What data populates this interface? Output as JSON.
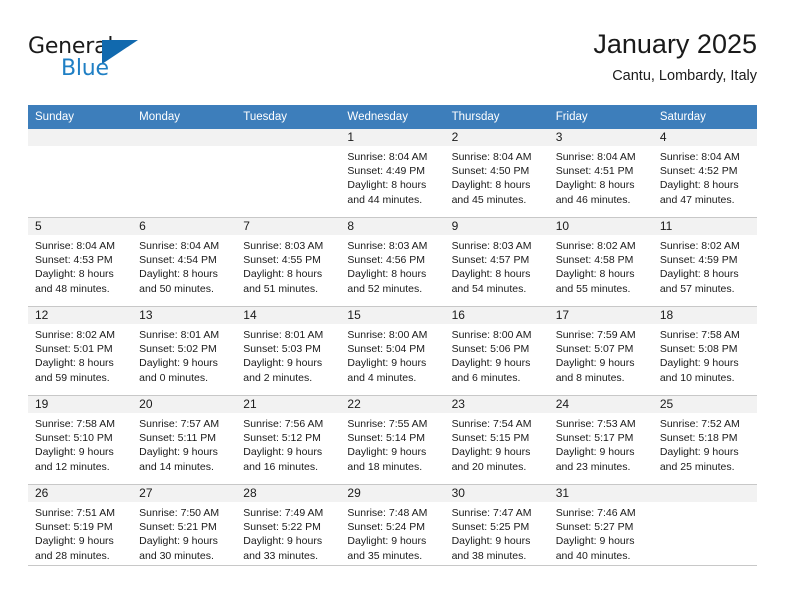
{
  "brand": {
    "name_top": "General",
    "name_bottom": "Blue",
    "accent_color": "#1169ae",
    "text_color": "#1a1a1a"
  },
  "header": {
    "title": "January 2025",
    "subtitle": "Cantu, Lombardy, Italy"
  },
  "theme": {
    "header_row_bg": "#3d7ebb",
    "header_row_text": "#ffffff",
    "daynum_band_bg": "#f2f2f2",
    "grid_line": "#c8c8c8"
  },
  "weekdays": [
    "Sunday",
    "Monday",
    "Tuesday",
    "Wednesday",
    "Thursday",
    "Friday",
    "Saturday"
  ],
  "weeks": [
    [
      {
        "day": "",
        "empty": true,
        "sunrise": "",
        "sunset": "",
        "daylight_line1": "",
        "daylight_line2": ""
      },
      {
        "day": "",
        "empty": true,
        "sunrise": "",
        "sunset": "",
        "daylight_line1": "",
        "daylight_line2": ""
      },
      {
        "day": "",
        "empty": true,
        "sunrise": "",
        "sunset": "",
        "daylight_line1": "",
        "daylight_line2": ""
      },
      {
        "day": "1",
        "empty": false,
        "sunrise": "Sunrise: 8:04 AM",
        "sunset": "Sunset: 4:49 PM",
        "daylight_line1": "Daylight: 8 hours",
        "daylight_line2": "and 44 minutes."
      },
      {
        "day": "2",
        "empty": false,
        "sunrise": "Sunrise: 8:04 AM",
        "sunset": "Sunset: 4:50 PM",
        "daylight_line1": "Daylight: 8 hours",
        "daylight_line2": "and 45 minutes."
      },
      {
        "day": "3",
        "empty": false,
        "sunrise": "Sunrise: 8:04 AM",
        "sunset": "Sunset: 4:51 PM",
        "daylight_line1": "Daylight: 8 hours",
        "daylight_line2": "and 46 minutes."
      },
      {
        "day": "4",
        "empty": false,
        "sunrise": "Sunrise: 8:04 AM",
        "sunset": "Sunset: 4:52 PM",
        "daylight_line1": "Daylight: 8 hours",
        "daylight_line2": "and 47 minutes."
      }
    ],
    [
      {
        "day": "5",
        "empty": false,
        "sunrise": "Sunrise: 8:04 AM",
        "sunset": "Sunset: 4:53 PM",
        "daylight_line1": "Daylight: 8 hours",
        "daylight_line2": "and 48 minutes."
      },
      {
        "day": "6",
        "empty": false,
        "sunrise": "Sunrise: 8:04 AM",
        "sunset": "Sunset: 4:54 PM",
        "daylight_line1": "Daylight: 8 hours",
        "daylight_line2": "and 50 minutes."
      },
      {
        "day": "7",
        "empty": false,
        "sunrise": "Sunrise: 8:03 AM",
        "sunset": "Sunset: 4:55 PM",
        "daylight_line1": "Daylight: 8 hours",
        "daylight_line2": "and 51 minutes."
      },
      {
        "day": "8",
        "empty": false,
        "sunrise": "Sunrise: 8:03 AM",
        "sunset": "Sunset: 4:56 PM",
        "daylight_line1": "Daylight: 8 hours",
        "daylight_line2": "and 52 minutes."
      },
      {
        "day": "9",
        "empty": false,
        "sunrise": "Sunrise: 8:03 AM",
        "sunset": "Sunset: 4:57 PM",
        "daylight_line1": "Daylight: 8 hours",
        "daylight_line2": "and 54 minutes."
      },
      {
        "day": "10",
        "empty": false,
        "sunrise": "Sunrise: 8:02 AM",
        "sunset": "Sunset: 4:58 PM",
        "daylight_line1": "Daylight: 8 hours",
        "daylight_line2": "and 55 minutes."
      },
      {
        "day": "11",
        "empty": false,
        "sunrise": "Sunrise: 8:02 AM",
        "sunset": "Sunset: 4:59 PM",
        "daylight_line1": "Daylight: 8 hours",
        "daylight_line2": "and 57 minutes."
      }
    ],
    [
      {
        "day": "12",
        "empty": false,
        "sunrise": "Sunrise: 8:02 AM",
        "sunset": "Sunset: 5:01 PM",
        "daylight_line1": "Daylight: 8 hours",
        "daylight_line2": "and 59 minutes."
      },
      {
        "day": "13",
        "empty": false,
        "sunrise": "Sunrise: 8:01 AM",
        "sunset": "Sunset: 5:02 PM",
        "daylight_line1": "Daylight: 9 hours",
        "daylight_line2": "and 0 minutes."
      },
      {
        "day": "14",
        "empty": false,
        "sunrise": "Sunrise: 8:01 AM",
        "sunset": "Sunset: 5:03 PM",
        "daylight_line1": "Daylight: 9 hours",
        "daylight_line2": "and 2 minutes."
      },
      {
        "day": "15",
        "empty": false,
        "sunrise": "Sunrise: 8:00 AM",
        "sunset": "Sunset: 5:04 PM",
        "daylight_line1": "Daylight: 9 hours",
        "daylight_line2": "and 4 minutes."
      },
      {
        "day": "16",
        "empty": false,
        "sunrise": "Sunrise: 8:00 AM",
        "sunset": "Sunset: 5:06 PM",
        "daylight_line1": "Daylight: 9 hours",
        "daylight_line2": "and 6 minutes."
      },
      {
        "day": "17",
        "empty": false,
        "sunrise": "Sunrise: 7:59 AM",
        "sunset": "Sunset: 5:07 PM",
        "daylight_line1": "Daylight: 9 hours",
        "daylight_line2": "and 8 minutes."
      },
      {
        "day": "18",
        "empty": false,
        "sunrise": "Sunrise: 7:58 AM",
        "sunset": "Sunset: 5:08 PM",
        "daylight_line1": "Daylight: 9 hours",
        "daylight_line2": "and 10 minutes."
      }
    ],
    [
      {
        "day": "19",
        "empty": false,
        "sunrise": "Sunrise: 7:58 AM",
        "sunset": "Sunset: 5:10 PM",
        "daylight_line1": "Daylight: 9 hours",
        "daylight_line2": "and 12 minutes."
      },
      {
        "day": "20",
        "empty": false,
        "sunrise": "Sunrise: 7:57 AM",
        "sunset": "Sunset: 5:11 PM",
        "daylight_line1": "Daylight: 9 hours",
        "daylight_line2": "and 14 minutes."
      },
      {
        "day": "21",
        "empty": false,
        "sunrise": "Sunrise: 7:56 AM",
        "sunset": "Sunset: 5:12 PM",
        "daylight_line1": "Daylight: 9 hours",
        "daylight_line2": "and 16 minutes."
      },
      {
        "day": "22",
        "empty": false,
        "sunrise": "Sunrise: 7:55 AM",
        "sunset": "Sunset: 5:14 PM",
        "daylight_line1": "Daylight: 9 hours",
        "daylight_line2": "and 18 minutes."
      },
      {
        "day": "23",
        "empty": false,
        "sunrise": "Sunrise: 7:54 AM",
        "sunset": "Sunset: 5:15 PM",
        "daylight_line1": "Daylight: 9 hours",
        "daylight_line2": "and 20 minutes."
      },
      {
        "day": "24",
        "empty": false,
        "sunrise": "Sunrise: 7:53 AM",
        "sunset": "Sunset: 5:17 PM",
        "daylight_line1": "Daylight: 9 hours",
        "daylight_line2": "and 23 minutes."
      },
      {
        "day": "25",
        "empty": false,
        "sunrise": "Sunrise: 7:52 AM",
        "sunset": "Sunset: 5:18 PM",
        "daylight_line1": "Daylight: 9 hours",
        "daylight_line2": "and 25 minutes."
      }
    ],
    [
      {
        "day": "26",
        "empty": false,
        "sunrise": "Sunrise: 7:51 AM",
        "sunset": "Sunset: 5:19 PM",
        "daylight_line1": "Daylight: 9 hours",
        "daylight_line2": "and 28 minutes."
      },
      {
        "day": "27",
        "empty": false,
        "sunrise": "Sunrise: 7:50 AM",
        "sunset": "Sunset: 5:21 PM",
        "daylight_line1": "Daylight: 9 hours",
        "daylight_line2": "and 30 minutes."
      },
      {
        "day": "28",
        "empty": false,
        "sunrise": "Sunrise: 7:49 AM",
        "sunset": "Sunset: 5:22 PM",
        "daylight_line1": "Daylight: 9 hours",
        "daylight_line2": "and 33 minutes."
      },
      {
        "day": "29",
        "empty": false,
        "sunrise": "Sunrise: 7:48 AM",
        "sunset": "Sunset: 5:24 PM",
        "daylight_line1": "Daylight: 9 hours",
        "daylight_line2": "and 35 minutes."
      },
      {
        "day": "30",
        "empty": false,
        "sunrise": "Sunrise: 7:47 AM",
        "sunset": "Sunset: 5:25 PM",
        "daylight_line1": "Daylight: 9 hours",
        "daylight_line2": "and 38 minutes."
      },
      {
        "day": "31",
        "empty": false,
        "sunrise": "Sunrise: 7:46 AM",
        "sunset": "Sunset: 5:27 PM",
        "daylight_line1": "Daylight: 9 hours",
        "daylight_line2": "and 40 minutes."
      },
      {
        "day": "",
        "empty": true,
        "sunrise": "",
        "sunset": "",
        "daylight_line1": "",
        "daylight_line2": ""
      }
    ]
  ]
}
